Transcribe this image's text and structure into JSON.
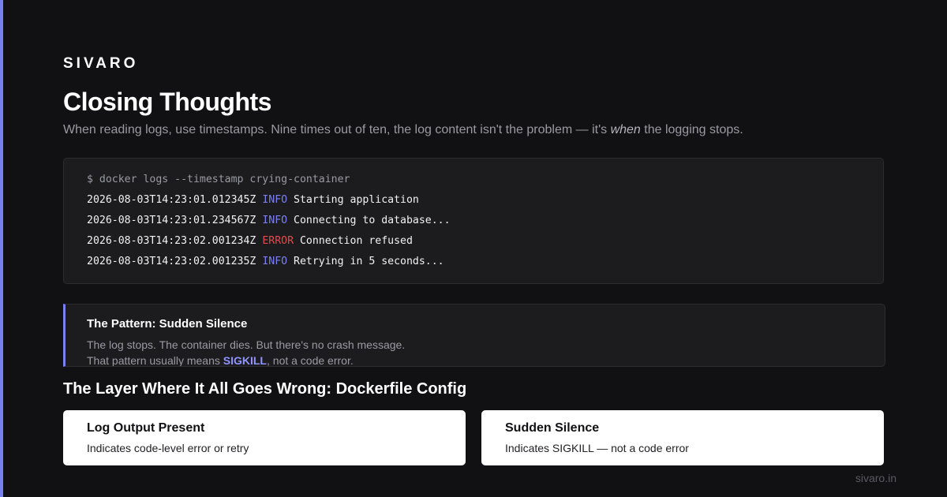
{
  "brand": "SIVARO",
  "title": "Closing Thoughts",
  "subtitle": {
    "before": "When reading logs, use timestamps. Nine times out of ten, the log content isn't the problem — it's ",
    "emphasis": "when",
    "after": " the logging stops."
  },
  "terminal": {
    "command": "$ docker logs --timestamp crying-container",
    "lines": [
      {
        "timestamp": "2026-08-03T14:23:01.012345Z",
        "level": "INFO",
        "message": "Starting application"
      },
      {
        "timestamp": "2026-08-03T14:23:01.234567Z",
        "level": "INFO",
        "message": "Connecting to database..."
      },
      {
        "timestamp": "2026-08-03T14:23:02.001234Z",
        "level": "ERROR",
        "message": "Connection refused"
      },
      {
        "timestamp": "2026-08-03T14:23:02.001235Z",
        "level": "INFO",
        "message": "Retrying in 5 seconds..."
      }
    ]
  },
  "callout": {
    "title": "The Pattern: Sudden Silence",
    "line1": "The log stops. The container dies. But there's no crash message.",
    "line2_before": "That pattern usually means ",
    "line2_strong": "SIGKILL",
    "line2_after": ", not a code error."
  },
  "section_heading": "The Layer Where It All Goes Wrong: Dockerfile Config",
  "cards": [
    {
      "title": "Log Output Present",
      "description": "Indicates code-level error or retry"
    },
    {
      "title": "Sudden Silence",
      "description": "Indicates SIGKILL — not a code error"
    }
  ],
  "footer": "sivaro.in",
  "colors": {
    "accent": "#7b80f0",
    "error": "#e5484d",
    "background": "#111113"
  }
}
